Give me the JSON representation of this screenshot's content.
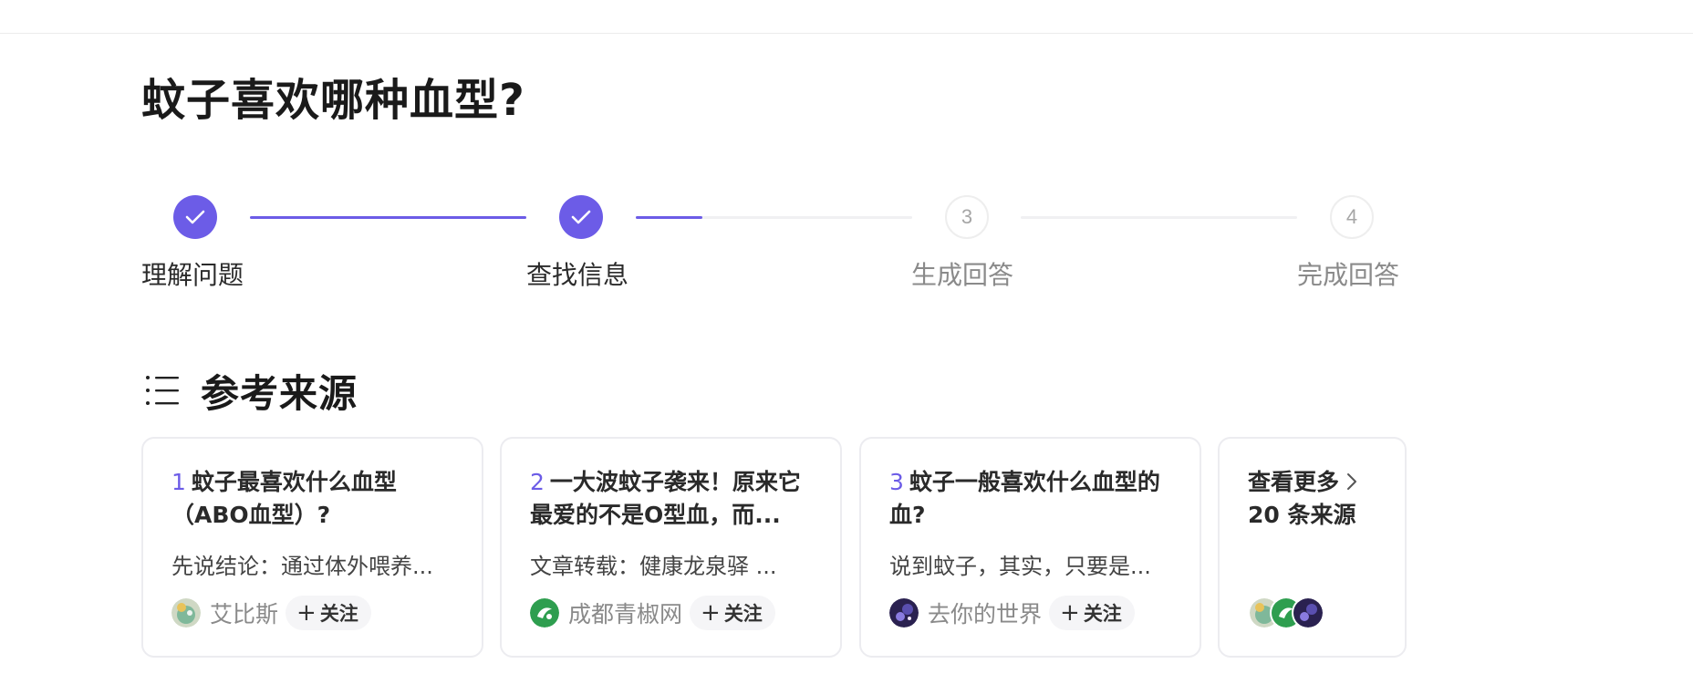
{
  "page": {
    "title": "蚊子喜欢哪种血型?"
  },
  "steps": [
    {
      "label": "理解问题",
      "state": "done"
    },
    {
      "label": "查找信息",
      "state": "done"
    },
    {
      "label": "生成回答",
      "state": "pending",
      "number": "3"
    },
    {
      "label": "完成回答",
      "state": "pending",
      "number": "4"
    }
  ],
  "progress": {
    "segment1_fraction": 1.0,
    "segment2_fraction": 0.24,
    "segment3_fraction": 0.0
  },
  "references": {
    "heading": "参考来源",
    "icon": "list-icon",
    "cards": [
      {
        "num": "1",
        "title": "蚊子最喜欢什么血型（ABO血型）?",
        "snippet": "先说结论：通过体外喂养...",
        "author": "艾比斯",
        "follow_label": "关注",
        "avatar_color": "#8fbf9a"
      },
      {
        "num": "2",
        "title": "一大波蚊子袭来！原来它最爱的不是O型血，而...",
        "snippet": "文章转载：健康龙泉驿 ...",
        "author": "成都青椒网",
        "follow_label": "关注",
        "avatar_color": "#2e9e4f"
      },
      {
        "num": "3",
        "title": "蚊子一般喜欢什么血型的血?",
        "snippet": "说到蚊子，其实，只要是...",
        "author": "去你的世界",
        "follow_label": "关注",
        "avatar_color": "#2a2150"
      }
    ],
    "more": {
      "label": "查看更多",
      "count_text": "20 条来源"
    }
  },
  "colors": {
    "accent": "#6c5ce7"
  }
}
